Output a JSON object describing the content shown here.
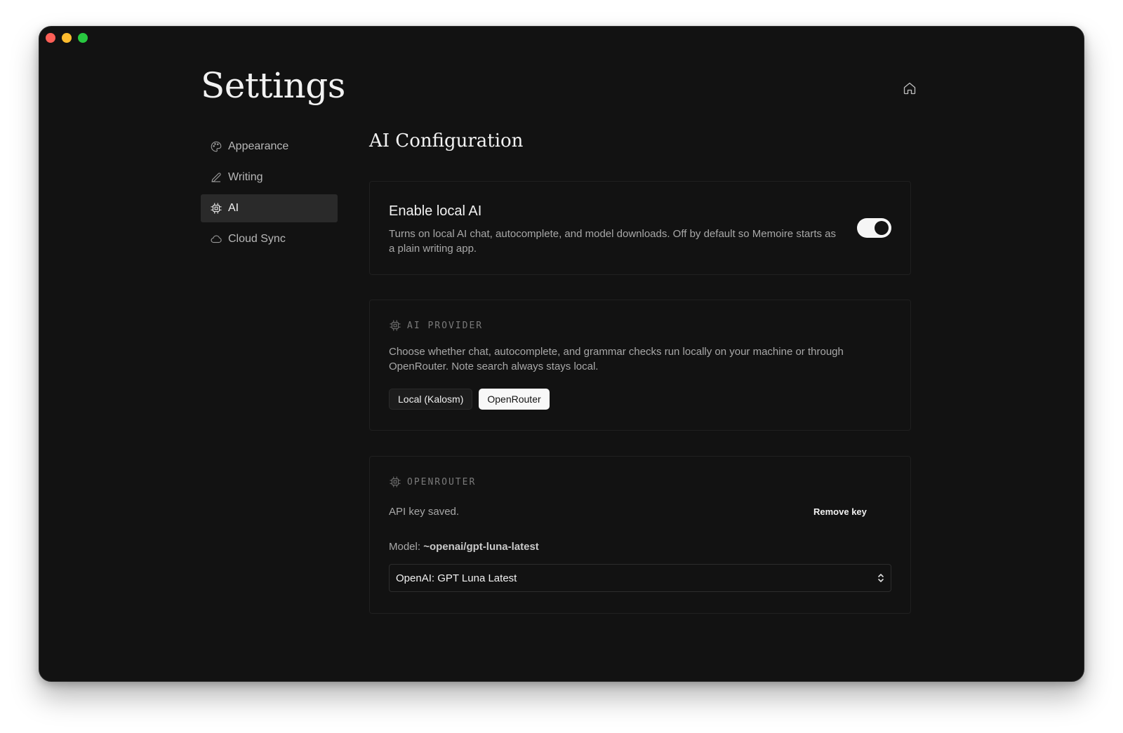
{
  "window": {
    "traffic_lights": {
      "close": "#fe5f57",
      "minimize": "#febc2e",
      "maximize": "#28c840"
    }
  },
  "page": {
    "title": "Settings",
    "home_icon": "home-icon"
  },
  "sidebar": {
    "items": [
      {
        "label": "Appearance",
        "icon": "palette-icon",
        "active": false
      },
      {
        "label": "Writing",
        "icon": "pencil-icon",
        "active": false
      },
      {
        "label": "AI",
        "icon": "chip-icon",
        "active": true
      },
      {
        "label": "Cloud Sync",
        "icon": "cloud-icon",
        "active": false
      }
    ]
  },
  "main": {
    "section_title": "AI Configuration",
    "local_ai": {
      "title": "Enable local AI",
      "description": "Turns on local AI chat, autocomplete, and model downloads. Off by default so Memoire starts as a plain writing app.",
      "enabled": true
    },
    "provider": {
      "label": "AI PROVIDER",
      "icon": "chip-icon",
      "description": "Choose whether chat, autocomplete, and grammar checks run locally on your machine or through OpenRouter. Note search always stays local.",
      "options": [
        "Local (Kalosm)",
        "OpenRouter"
      ],
      "selected": "OpenRouter"
    },
    "openrouter": {
      "label": "OPENROUTER",
      "icon": "chip-icon",
      "api_status": "API key saved.",
      "remove_key_label": "Remove key",
      "model_prefix": "Model:",
      "model_value": "~openai/gpt-luna-latest",
      "model_select_value": "OpenAI: GPT Luna Latest"
    }
  },
  "colors": {
    "background": "#121212",
    "text_primary": "#f2f2f2",
    "text_secondary": "#a8a8a8",
    "active_nav": "#2a2a2a",
    "toggle_on": "#f5f5f5"
  }
}
